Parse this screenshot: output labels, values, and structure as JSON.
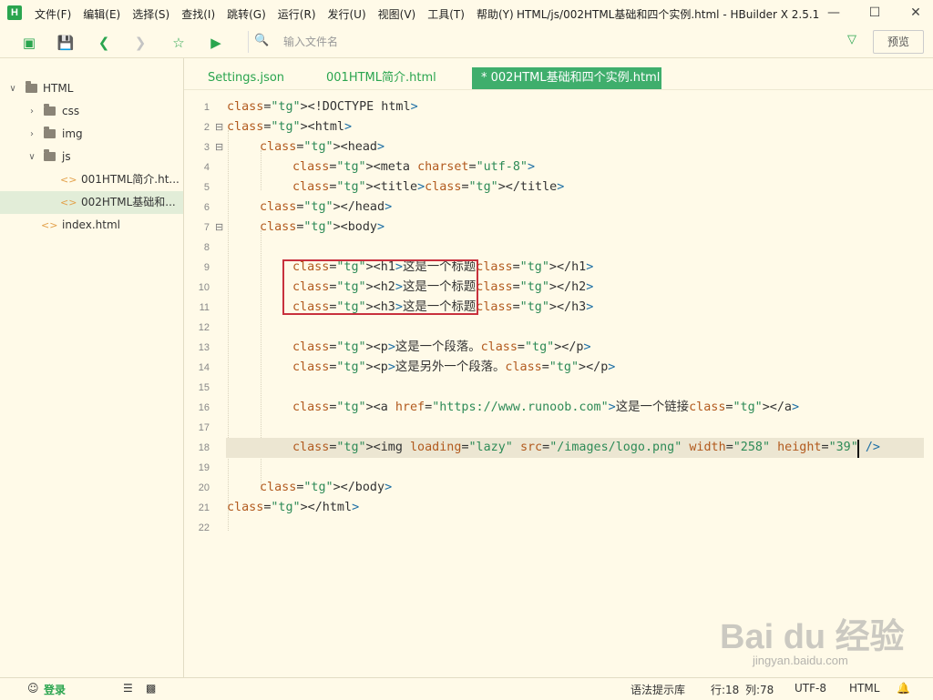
{
  "app": {
    "logo_letter": "H"
  },
  "menu": [
    "文件(F)",
    "编辑(E)",
    "选择(S)",
    "查找(I)",
    "跳转(G)",
    "运行(R)",
    "发行(U)",
    "视图(V)",
    "工具(T)",
    "帮助(Y)"
  ],
  "window": {
    "title": "HTML/js/002HTML基础和四个实例.html - HBuilder X 2.5.1"
  },
  "toolbar": {
    "file_input_placeholder": "输入文件名",
    "preview_label": "预览"
  },
  "tree": {
    "root": "HTML",
    "items": [
      {
        "label": "css"
      },
      {
        "label": "img"
      },
      {
        "label": "js"
      },
      {
        "label": "001HTML简介.ht..."
      },
      {
        "label": "002HTML基础和..."
      },
      {
        "label": "index.html"
      }
    ]
  },
  "tabs": [
    {
      "label": "Settings.json"
    },
    {
      "label": "001HTML简介.html"
    },
    {
      "label": "* 002HTML基础和四个实例.html"
    }
  ],
  "editor": {
    "line_numbers": [
      "1",
      "2",
      "3",
      "4",
      "5",
      "6",
      "7",
      "8",
      "9",
      "10",
      "11",
      "12",
      "13",
      "14",
      "15",
      "16",
      "17",
      "18",
      "19",
      "20",
      "21",
      "22"
    ],
    "lines": [
      "<!DOCTYPE html>",
      "<html>",
      "<head>",
      "<meta charset=\"utf-8\">",
      "<title></title>",
      "</head>",
      "<body>",
      "",
      "<h1>这是一个标题</h1>",
      "<h2>这是一个标题</h2>",
      "<h3>这是一个标题</h3>",
      "",
      "<p>这是一个段落。</p>",
      "<p>这是另外一个段落。</p>",
      "",
      "<a href=\"https://www.runoob.com\">这是一个链接</a>",
      "",
      "<img loading=\"lazy\" src=\"/images/logo.png\" width=\"258\" height=\"39\" />",
      "",
      "</body>",
      "</html>",
      ""
    ],
    "current_line": 18,
    "highlight_box": "h1-h3 headings"
  },
  "status": {
    "login": "登录",
    "hint_lib": "语法提示库",
    "row": "行:18",
    "col": "列:78",
    "encoding": "UTF-8",
    "language": "HTML"
  },
  "watermark": {
    "main": "Bai du 经验",
    "sub": "jingyan.baidu.com"
  },
  "colors": {
    "accent": "#2aa54f",
    "tab_active": "#3fae6c",
    "highlight_box": "#c8313d",
    "background": "#fffae8"
  }
}
